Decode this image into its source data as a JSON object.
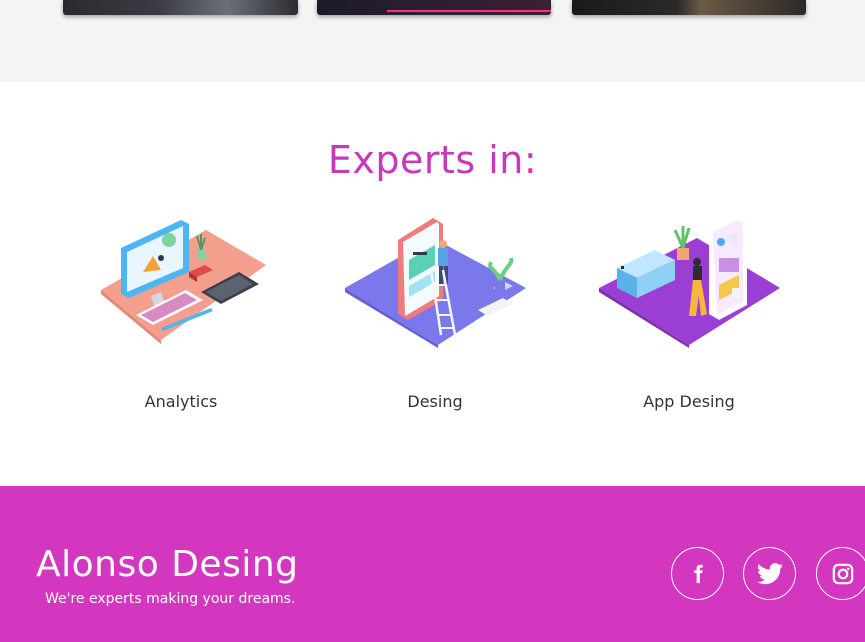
{
  "experts": {
    "title": "Experts in:",
    "items": [
      {
        "label": "Analytics",
        "icon": "analytics-workspace-illustration"
      },
      {
        "label": "Desing",
        "icon": "design-board-illustration"
      },
      {
        "label": "App Desing",
        "icon": "app-design-illustration"
      }
    ]
  },
  "footer": {
    "brand": "Alonso Desing",
    "tagline": "We're experts making your dreams.",
    "social": [
      {
        "name": "facebook-icon"
      },
      {
        "name": "twitter-icon"
      },
      {
        "name": "instagram-icon"
      }
    ]
  },
  "colors": {
    "accent": "#c73ab6",
    "footer_bg": "#d437bf",
    "text_dark": "#333333"
  }
}
